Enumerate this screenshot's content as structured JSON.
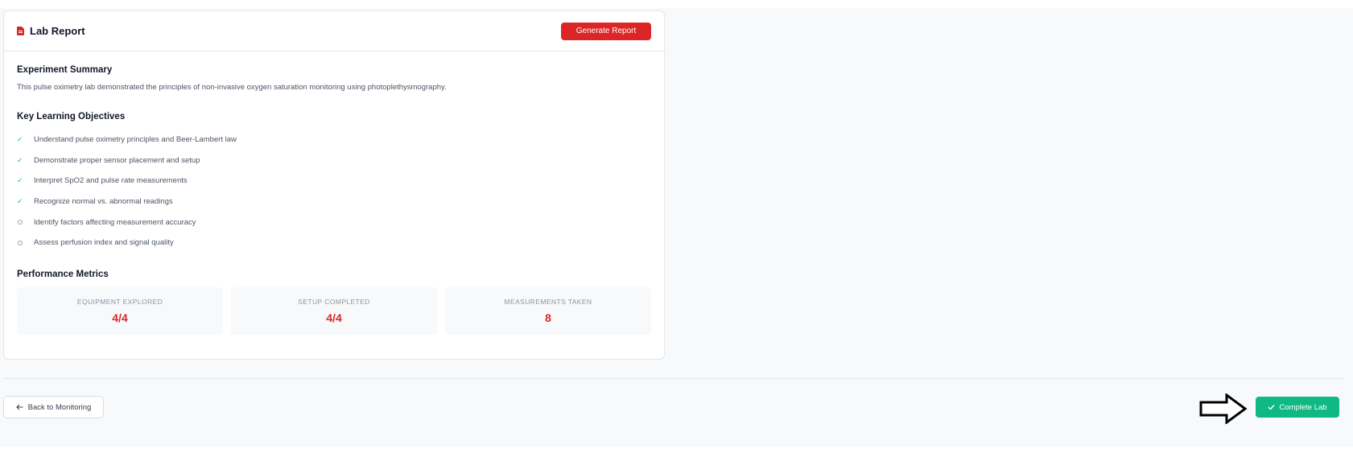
{
  "report": {
    "title": "Lab Report",
    "title_icon": "file-icon",
    "generate_label": "Generate Report"
  },
  "summary": {
    "heading": "Experiment Summary",
    "text": "This pulse oximetry lab demonstrated the principles of non-invasive oxygen saturation monitoring using photoplethysmography."
  },
  "objectives": {
    "heading": "Key Learning Objectives",
    "items": [
      {
        "label": "Understand pulse oximetry principles and Beer-Lambert law",
        "done": true
      },
      {
        "label": "Demonstrate proper sensor placement and setup",
        "done": true
      },
      {
        "label": "Interpret SpO2 and pulse rate measurements",
        "done": true
      },
      {
        "label": "Recognize normal vs. abnormal readings",
        "done": true
      },
      {
        "label": "Identify factors affecting measurement accuracy",
        "done": false
      },
      {
        "label": "Assess perfusion index and signal quality",
        "done": false
      }
    ]
  },
  "metrics": {
    "heading": "Performance Metrics",
    "items": [
      {
        "label": "EQUIPMENT EXPLORED",
        "value": "4/4"
      },
      {
        "label": "SETUP COMPLETED",
        "value": "4/4"
      },
      {
        "label": "MEASUREMENTS TAKEN",
        "value": "8"
      }
    ]
  },
  "footer": {
    "back_label": "Back to Monitoring",
    "complete_label": "Complete Lab"
  },
  "colors": {
    "accent_red": "#dc2626",
    "success_green": "#10b981"
  }
}
